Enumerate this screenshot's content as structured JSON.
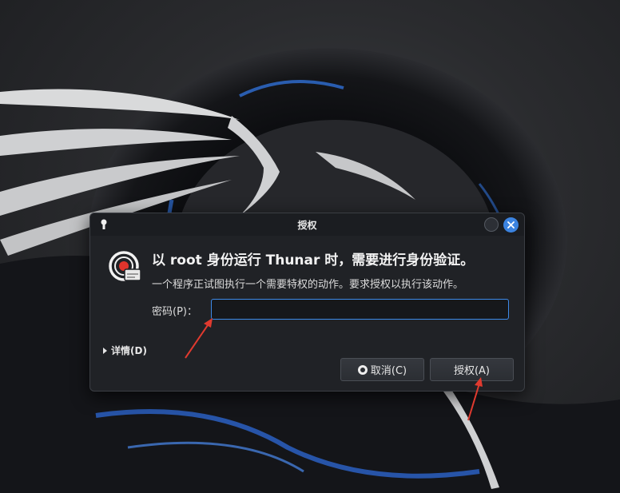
{
  "dialog": {
    "title": "授权",
    "heading": "以 root 身份运行 Thunar 时，需要进行身份验证。",
    "message": "一个程序正试图执行一个需要特权的动作。要求授权以执行该动作。",
    "password_label": "密码(P)：",
    "password_value": "",
    "details_label": "详情(D)",
    "cancel_label": "取消(C)",
    "authenticate_label": "授权(A)"
  },
  "colors": {
    "accent": "#3d8ae8",
    "close_button": "#3b83e0",
    "arrow": "#e03a2f"
  },
  "icons": {
    "title": "keyhole-icon",
    "auth": "lock-shield-icon",
    "close": "close-icon",
    "minimize": "minimize-icon",
    "cancel": "cancel-icon",
    "details": "disclosure-triangle-icon"
  }
}
